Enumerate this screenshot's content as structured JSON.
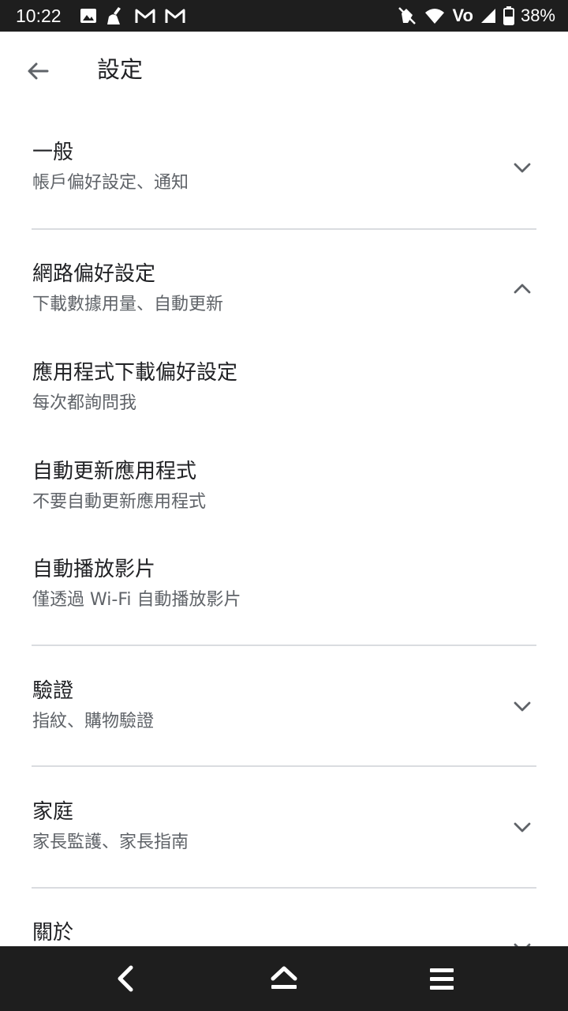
{
  "status_bar": {
    "time": "10:22",
    "left_icons": [
      "image-icon",
      "cleaner-icon",
      "gmail-icon",
      "gmail-icon"
    ],
    "right_icons": [
      "mute-hand-icon",
      "wifi-icon",
      "volte-icon",
      "signal-icon",
      "battery-icon"
    ],
    "volte_label": "Vo",
    "battery": "38%"
  },
  "app_bar": {
    "title": "設定",
    "back_icon": "arrow-back-icon"
  },
  "settings": {
    "general": {
      "title": "一般",
      "subtitle": "帳戶偏好設定、通知",
      "state": "collapsed"
    },
    "network": {
      "title": "網路偏好設定",
      "subtitle": "下載數據用量、自動更新",
      "state": "expanded"
    },
    "app_download": {
      "title": "應用程式下載偏好設定",
      "subtitle": "每次都詢問我"
    },
    "auto_update": {
      "title": "自動更新應用程式",
      "subtitle": "不要自動更新應用程式"
    },
    "autoplay": {
      "title": "自動播放影片",
      "subtitle": "僅透過 Wi-Fi 自動播放影片"
    },
    "auth": {
      "title": "驗證",
      "subtitle": "指紋、購物驗證",
      "state": "collapsed"
    },
    "family": {
      "title": "家庭",
      "subtitle": "家長監護、家長指南",
      "state": "collapsed"
    },
    "about": {
      "title": "關於",
      "state": "collapsed"
    }
  },
  "nav_bar": {
    "icons": [
      "nav-back-icon",
      "nav-home-icon",
      "nav-menu-icon"
    ]
  },
  "colors": {
    "status_bar_bg": "#1e1e1e",
    "text_primary": "#202124",
    "text_secondary": "#5f6368",
    "divider": "#dadce0"
  }
}
